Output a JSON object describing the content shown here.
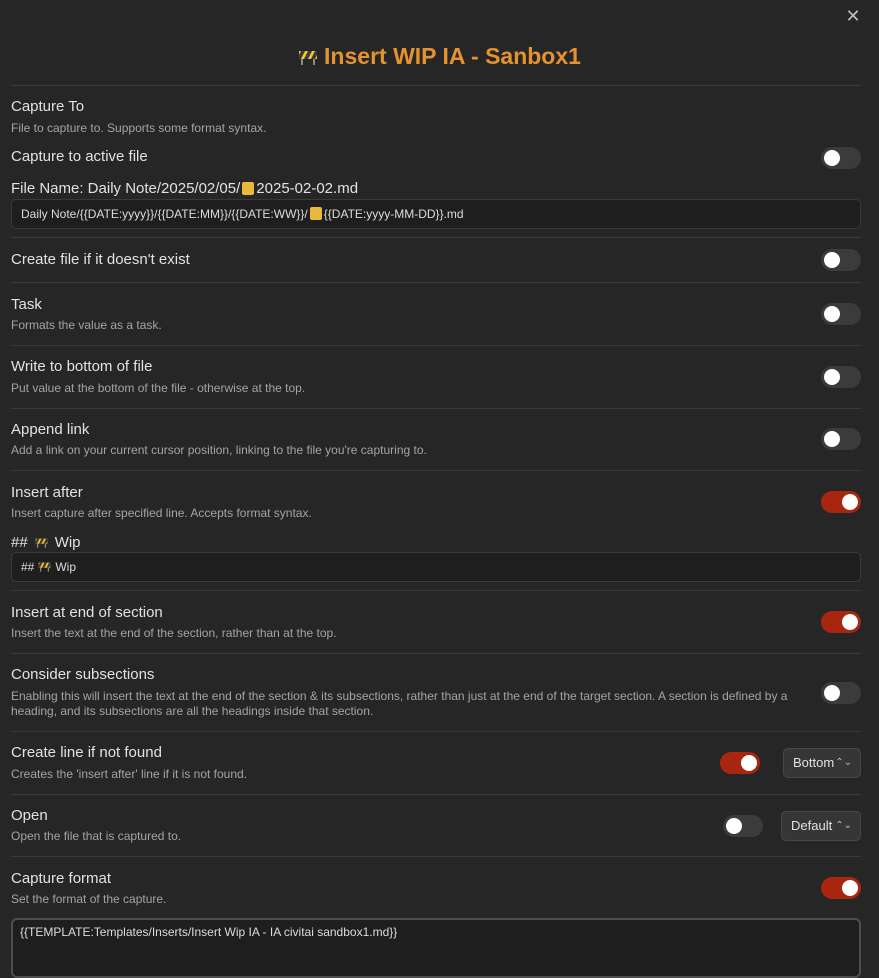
{
  "title": "Insert WIP IA - Sanbox1",
  "capture_to": {
    "name": "Capture To",
    "desc": "File to capture to. Supports some format syntax."
  },
  "capture_active": {
    "name": "Capture to active file",
    "on": false
  },
  "file_name": {
    "label_prefix": "File Name: Daily Note/2025/02/05/",
    "label_suffix": "2025-02-02.md",
    "value_prefix": "Daily Note/{{DATE:yyyy}}/{{DATE:MM}}/{{DATE:WW}}/",
    "value_suffix": "{{DATE:yyyy-MM-DD}}.md"
  },
  "create_file": {
    "name": "Create file if it doesn't exist",
    "on": false
  },
  "task": {
    "name": "Task",
    "desc": "Formats the value as a task.",
    "on": false
  },
  "write_bottom": {
    "name": "Write to bottom of file",
    "desc": "Put value at the bottom of the file - otherwise at the top.",
    "on": false
  },
  "append_link": {
    "name": "Append link",
    "desc": "Add a link on your current cursor position, linking to the file you're capturing to.",
    "on": false
  },
  "insert_after": {
    "name": "Insert after",
    "desc": "Insert capture after specified line. Accepts format syntax.",
    "on": true,
    "heading_hash": "##",
    "heading_text": "Wip",
    "value_hash": "##",
    "value_text": "Wip"
  },
  "end_section": {
    "name": "Insert at end of section",
    "desc": "Insert the text at the end of the section, rather than at the top.",
    "on": true
  },
  "subsections": {
    "name": "Consider subsections",
    "desc": "Enabling this will insert the text at the end of the section & its subsections, rather than just at the end of the target section. A section is defined by a heading, and its subsections are all the headings inside that section.",
    "on": false
  },
  "create_line": {
    "name": "Create line if not found",
    "desc": "Creates the 'insert after' line if it is not found.",
    "on": true,
    "select": "Bottom"
  },
  "open": {
    "name": "Open",
    "desc": "Open the file that is captured to.",
    "on": false,
    "select": "Default"
  },
  "capture_format": {
    "name": "Capture format",
    "desc": "Set the format of the capture.",
    "on": true,
    "value": "{{TEMPLATE:Templates/Inserts/Insert Wip IA - IA civitai sandbox1.md}}"
  },
  "colors": {
    "accent": "#e3932f",
    "toggle_on": "#a8250f",
    "background": "#262626"
  },
  "icons": {
    "close": "close-icon",
    "title": "construction-icon",
    "file": "notebook-icon",
    "heading": "construction-icon"
  }
}
